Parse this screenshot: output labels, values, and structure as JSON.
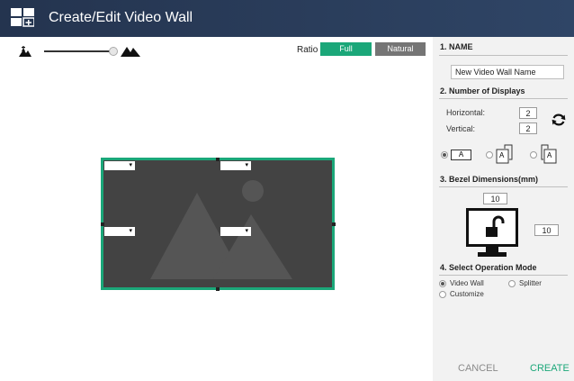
{
  "header": {
    "title": "Create/Edit Video Wall"
  },
  "toolbar": {
    "ratio_label": "Ratio",
    "full_label": "Full",
    "natural_label": "Natural"
  },
  "wall": {
    "selects": [
      "▾",
      "▾",
      "▾",
      "▾"
    ]
  },
  "panel": {
    "name_title": "1. NAME",
    "name_value": "New Video Wall Name",
    "displays_title": "2. Number of Displays",
    "horizontal_label": "Horizontal:",
    "horizontal_value": "2",
    "vertical_label": "Vertical:",
    "vertical_value": "2",
    "orientation_options": [
      "A",
      "A",
      "A"
    ],
    "bezel_title": "3. Bezel Dimensions(mm)",
    "bezel_top": "10",
    "bezel_right": "10",
    "mode_title": "4. Select Operation Mode",
    "mode_videowall": "Video Wall",
    "mode_splitter": "Splitter",
    "mode_customize": "Customize",
    "cancel_label": "CANCEL",
    "create_label": "CREATE"
  },
  "colors": {
    "accent": "#1ba779",
    "header": "#2a3d5b",
    "panel": "#f2f2f2",
    "wall": "#434343"
  }
}
